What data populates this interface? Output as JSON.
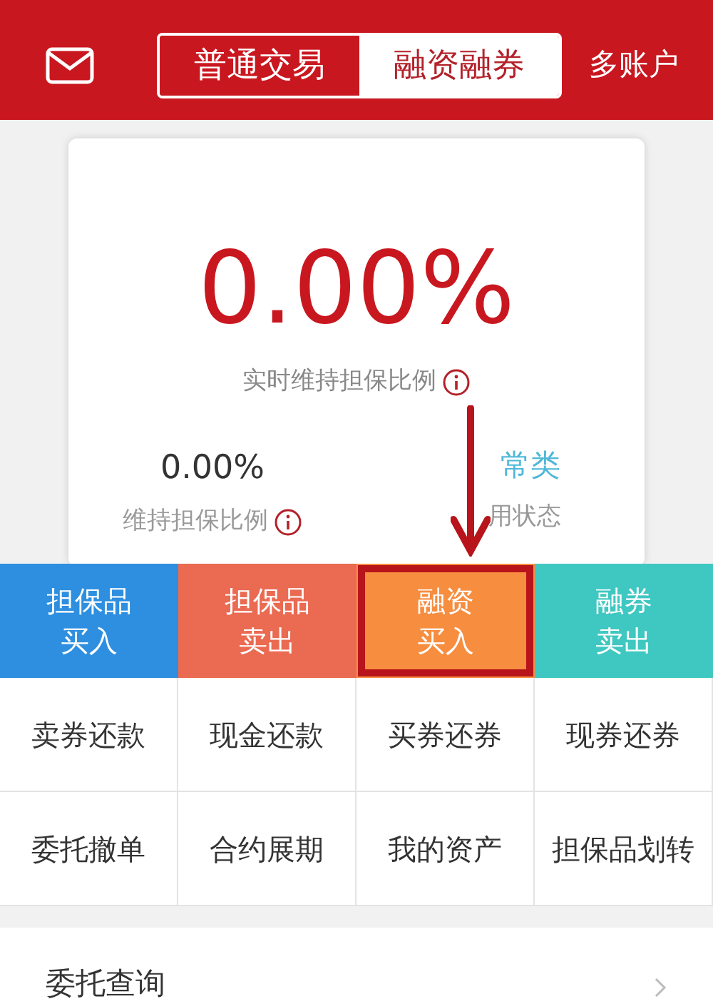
{
  "header": {
    "tabs": [
      {
        "label": "普通交易",
        "selected": false
      },
      {
        "label": "融资融券",
        "selected": true
      }
    ],
    "multi_account": "多账户"
  },
  "summary": {
    "ratio": "0.00%",
    "ratio_label": "实时维持担保比例",
    "maintain_value": "0.00%",
    "maintain_label": "维持担保比例",
    "credit_value": "常类",
    "credit_label": "用状态"
  },
  "actions": [
    {
      "line1": "担保品",
      "line2": "买入",
      "color": "#2e8fe0",
      "highlighted": false
    },
    {
      "line1": "担保品",
      "line2": "卖出",
      "color": "#ea6a52",
      "highlighted": false
    },
    {
      "line1": "融资",
      "line2": "买入",
      "color": "#f78d3f",
      "highlighted": true
    },
    {
      "line1": "融券",
      "line2": "卖出",
      "color": "#3fc7c1",
      "highlighted": false
    }
  ],
  "functions": [
    "卖券还款",
    "现金还款",
    "买券还券",
    "现券还券",
    "委托撤单",
    "合约展期",
    "我的资产",
    "担保品划转"
  ],
  "list": [
    {
      "label": "委托查询"
    }
  ]
}
